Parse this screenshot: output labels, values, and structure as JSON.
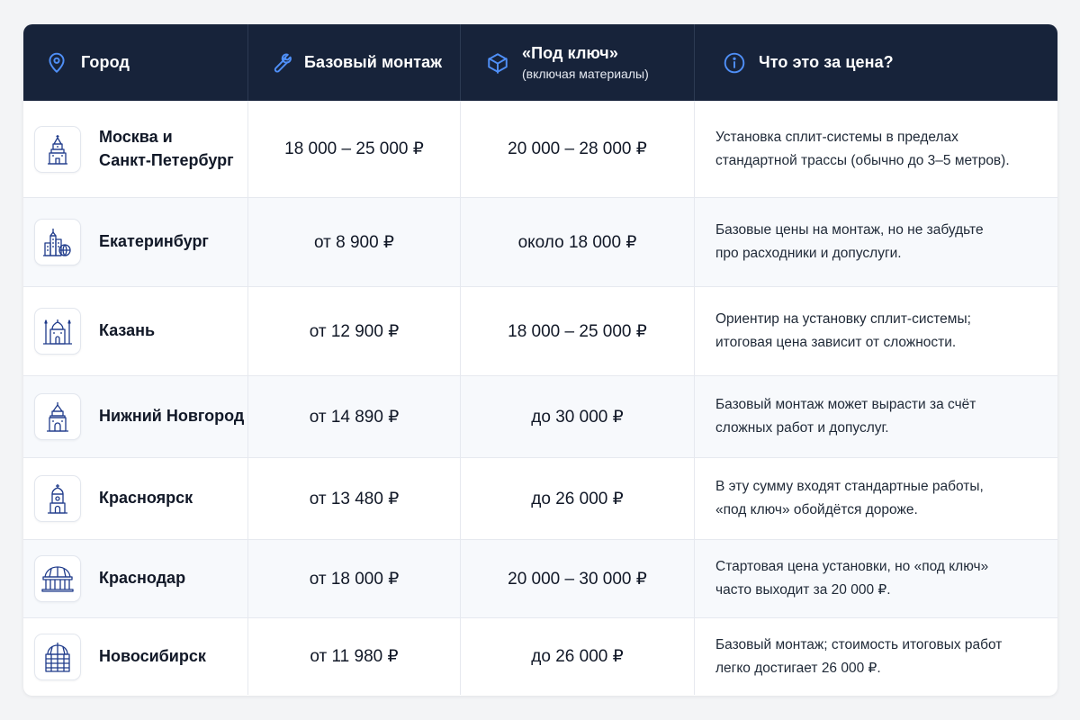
{
  "header": {
    "city": "Город",
    "basic": "Базовый монтаж",
    "turnkey": "«Под ключ»",
    "turnkey_sub": "(включая материалы)",
    "what": "Что это за цена?"
  },
  "rows": [
    {
      "city_line1": "Москва и",
      "city_line2": "Санкт-Петербург",
      "basic": "18 000 – 25 000 ₽",
      "turnkey": "20 000 – 28 000 ₽",
      "desc_line1": "Установка сплит-системы в пределах",
      "desc_line2": "стандартной трассы (обычно до 3–5 метров).",
      "icon": "kremlin-tower-icon"
    },
    {
      "city_line1": "Екатеринбург",
      "basic": "от 8 900 ₽",
      "turnkey": "около 18 000 ₽",
      "desc_line1": "Базовые цены на монтаж, но не забудьте",
      "desc_line2": "про расходники и допуслуги.",
      "icon": "city-buildings-icon"
    },
    {
      "city_line1": "Казань",
      "basic": "от 12 900 ₽",
      "turnkey": "18 000 – 25 000 ₽",
      "desc_line1": "Ориентир на установку сплит-системы;",
      "desc_line2": "итоговая цена зависит от сложности.",
      "icon": "mosque-icon"
    },
    {
      "city_line1": "Нижний Новгород",
      "basic": "от 14 890 ₽",
      "turnkey": "до 30 000 ₽",
      "desc_line1": "Базовый монтаж может вырасти за счёт",
      "desc_line2": "сложных работ и допуслуг.",
      "icon": "fortress-tower-icon"
    },
    {
      "city_line1": "Красноярск",
      "basic": "от 13 480 ₽",
      "turnkey": "до 26 000 ₽",
      "desc_line1": "В эту сумму входят стандартные работы,",
      "desc_line2": "«под ключ» обойдётся дороже.",
      "icon": "chapel-icon"
    },
    {
      "city_line1": "Краснодар",
      "basic": "от 18 000 ₽",
      "turnkey": "20 000 – 30 000 ₽",
      "desc_line1": "Стартовая цена установки, но «под ключ»",
      "desc_line2": "часто выходит за 20 000 ₽.",
      "icon": "rotunda-icon"
    },
    {
      "city_line1": "Новосибирск",
      "basic": "от 11 980 ₽",
      "turnkey": "до 26 000 ₽",
      "desc_line1": "Базовый монтаж; стоимость итоговых работ",
      "desc_line2": "легко достигает 26 000 ₽.",
      "icon": "dome-building-icon"
    }
  ],
  "colors": {
    "header_bg": "#17233a",
    "accent": "#3b82f6",
    "icon_stroke": "#1e3a8a"
  }
}
